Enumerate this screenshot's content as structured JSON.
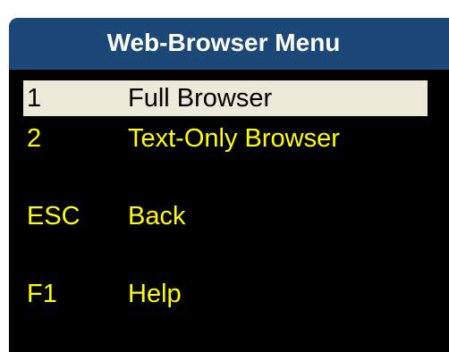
{
  "menu": {
    "title": "Web-Browser Menu",
    "items": [
      {
        "key": "1",
        "label": "Full Browser",
        "selected": true
      },
      {
        "key": "2",
        "label": "Text-Only Browser",
        "selected": false
      },
      {
        "key": "ESC",
        "label": "Back",
        "selected": false
      },
      {
        "key": "F1",
        "label": "Help",
        "selected": false
      }
    ]
  },
  "colors": {
    "title_bar": "#1c4878",
    "background": "#000000",
    "item_text": "#ffff00",
    "selected_bg": "#ece9d8",
    "selected_text": "#000000"
  }
}
